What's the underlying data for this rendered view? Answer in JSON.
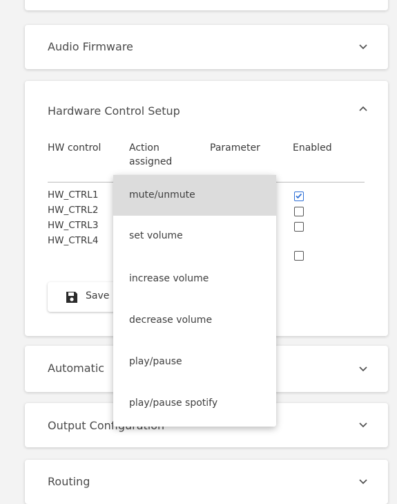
{
  "panels": {
    "audio_firmware": {
      "title": "Audio Firmware"
    },
    "hardware_control": {
      "title": "Hardware Control Setup"
    },
    "automatic": {
      "title": "Automatic"
    },
    "output_configuration": {
      "title": "Output Configuration"
    },
    "routing": {
      "title": "Routing"
    }
  },
  "hw_table": {
    "headers": {
      "control": "HW control",
      "action": "Action assigned",
      "parameter": "Parameter",
      "enabled": "Enabled"
    },
    "rows": [
      {
        "control": "HW_CTRL1",
        "enabled": true
      },
      {
        "control": "HW_CTRL2",
        "enabled": false
      },
      {
        "control": "HW_CTRL3",
        "enabled": false
      },
      {
        "control": "HW_CTRL4",
        "enabled": false
      }
    ]
  },
  "save_button": {
    "label": "Save",
    "icon": "save-icon"
  },
  "action_menu": {
    "selected": "mute/unmute",
    "options": [
      "mute/unmute",
      "set volume",
      "increase volume",
      "decrease volume",
      "play/pause",
      "play/pause spotify"
    ]
  },
  "colors": {
    "background": "#f3f3f3",
    "panel": "#ffffff",
    "checkbox_accent": "#2e6fd6",
    "menu_selected": "#dcdcdc"
  }
}
